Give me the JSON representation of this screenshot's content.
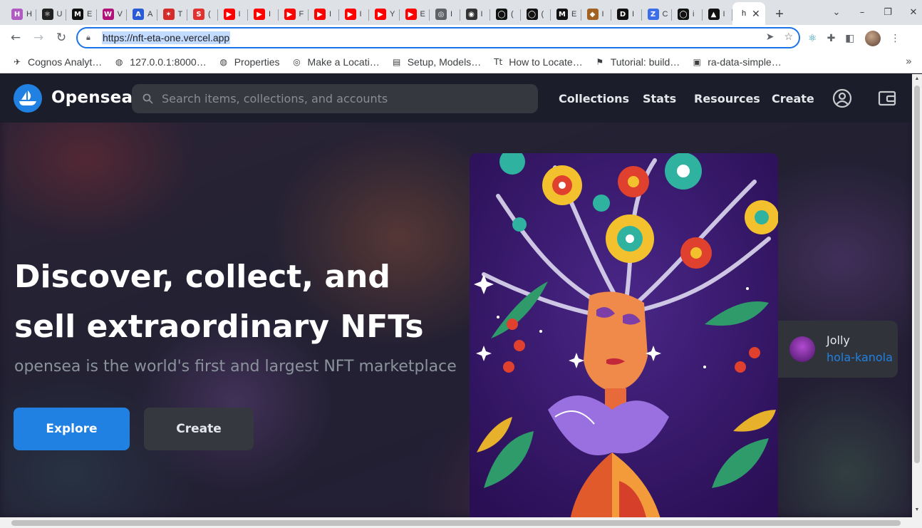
{
  "browser": {
    "tabs": [
      {
        "letter": "H",
        "color": "#b15bc2",
        "icon": "h-letter-icon",
        "title": "H"
      },
      {
        "letter": "⚛",
        "color": "#222",
        "icon": "react-icon",
        "title": "U"
      },
      {
        "letter": "M",
        "color": "#111",
        "icon": "medium-icon",
        "title": "E"
      },
      {
        "letter": "W",
        "color": "#b0127a",
        "icon": "w-icon",
        "title": "V"
      },
      {
        "letter": "A",
        "color": "#2a5bd7",
        "icon": "a-triangle-icon",
        "title": "A"
      },
      {
        "letter": "✶",
        "color": "#d42b2b",
        "icon": "figure-icon",
        "title": "T"
      },
      {
        "letter": "S",
        "color": "#e0332f",
        "icon": "s-icon",
        "title": "("
      },
      {
        "letter": "▶",
        "color": "#ff0000",
        "icon": "youtube-icon",
        "title": "I"
      },
      {
        "letter": "▶",
        "color": "#ff0000",
        "icon": "youtube-icon",
        "title": "I"
      },
      {
        "letter": "▶",
        "color": "#ff0000",
        "icon": "youtube-icon",
        "title": "F"
      },
      {
        "letter": "▶",
        "color": "#ff0000",
        "icon": "youtube-icon",
        "title": "I"
      },
      {
        "letter": "▶",
        "color": "#ff0000",
        "icon": "youtube-icon",
        "title": "I"
      },
      {
        "letter": "▶",
        "color": "#ff0000",
        "icon": "youtube-icon",
        "title": "Y"
      },
      {
        "letter": "▶",
        "color": "#ff0000",
        "icon": "youtube-icon",
        "title": "E"
      },
      {
        "letter": "◎",
        "color": "#5f6368",
        "icon": "globe-icon",
        "title": "I"
      },
      {
        "letter": "◉",
        "color": "#333",
        "icon": "android-icon",
        "title": "I"
      },
      {
        "letter": "◯",
        "color": "#111",
        "icon": "github-icon",
        "title": "("
      },
      {
        "letter": "◯",
        "color": "#111",
        "icon": "github-icon",
        "title": "("
      },
      {
        "letter": "M",
        "color": "#111",
        "icon": "medium-icon",
        "title": "E"
      },
      {
        "letter": "◆",
        "color": "#a0621e",
        "icon": "diamond-icon",
        "title": "I"
      },
      {
        "letter": "D",
        "color": "#111",
        "icon": "dev-icon",
        "title": "I"
      },
      {
        "letter": "Z",
        "color": "#3b6ee8",
        "icon": "z-icon",
        "title": "C"
      },
      {
        "letter": "◯",
        "color": "#111",
        "icon": "github-icon",
        "title": "i"
      },
      {
        "letter": "▲",
        "color": "#111",
        "icon": "vercel-icon",
        "title": "I"
      }
    ],
    "active_tab": {
      "letter": "h",
      "title": "h"
    },
    "new_tab": "+",
    "url": "https://nft-eta-one.vercel.app",
    "bookmarks": [
      {
        "icon": "cognos-icon",
        "glyph": "✈",
        "label": "Cognos Analyt…"
      },
      {
        "icon": "globe-icon",
        "glyph": "◍",
        "label": "127.0.0.1:8000…"
      },
      {
        "icon": "globe-icon",
        "glyph": "◍",
        "label": "Properties"
      },
      {
        "icon": "compass-icon",
        "glyph": "◎",
        "label": "Make a Locati…"
      },
      {
        "icon": "book-icon",
        "glyph": "▤",
        "label": "Setup, Models…"
      },
      {
        "icon": "tt-icon",
        "glyph": "Tt",
        "label": "How to Locate…"
      },
      {
        "icon": "flag-icon",
        "glyph": "⚑",
        "label": "Tutorial: build…"
      },
      {
        "icon": "ra-icon",
        "glyph": "▣",
        "label": "ra-data-simple…"
      }
    ]
  },
  "site": {
    "brand": "Opensea",
    "search_placeholder": "Search items, collections, and accounts",
    "nav": [
      "Collections",
      "Stats",
      "Resources",
      "Create"
    ],
    "hero_title": "Discover, collect, and sell extraordinary NFTs",
    "hero_subtitle": "opensea is the world's first and largest NFT marketplace",
    "explore_label": "Explore",
    "create_label": "Create",
    "card": {
      "name": "Jolly",
      "handle": "hola-kanola"
    },
    "colors": {
      "accent": "#2081e2",
      "header": "#1b1d2b",
      "input": "#363840"
    }
  }
}
